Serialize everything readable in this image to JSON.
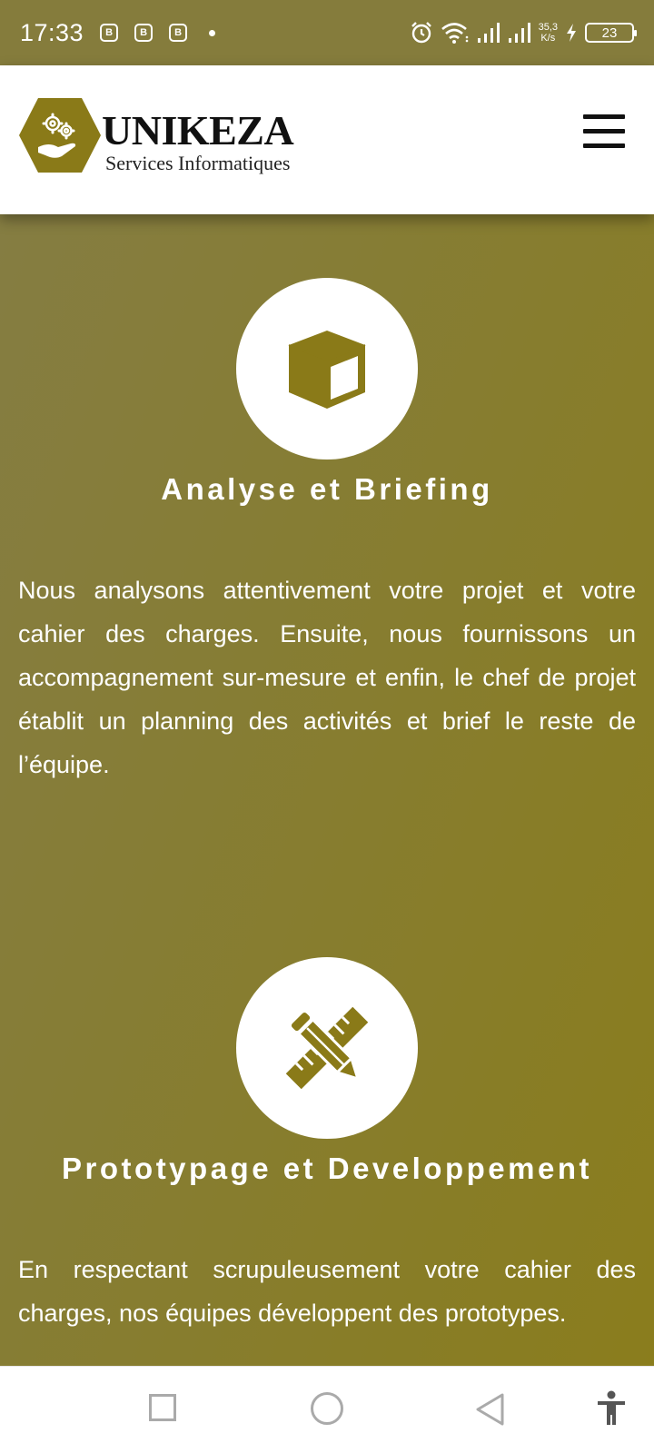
{
  "status_bar": {
    "time": "17:33",
    "notification_icon_text": "B",
    "net_speed_value": "35,3",
    "net_speed_unit": "K/s",
    "battery": "23"
  },
  "header": {
    "brand_name": "UNIKEZA",
    "brand_subtitle": "Services Informatiques",
    "logo_color": "#8a7a18"
  },
  "sections": [
    {
      "icon": "cube-icon",
      "title": "Analyse et Briefing",
      "text": "Nous analysons attentivement votre projet et votre cahier des charges. Ensuite, nous fournissons un accompagnement sur-mesure et enfin, le chef de projet établit un planning des activités et brief le reste de l’équipe."
    },
    {
      "icon": "pencil-ruler-icon",
      "title": "Prototypage et Developpement",
      "text": "En  respectant scrupuleusement votre cahier des charges, nos équipes développent des prototypes."
    }
  ],
  "colors": {
    "accent": "#8a7a18",
    "background": "#877d2e"
  }
}
